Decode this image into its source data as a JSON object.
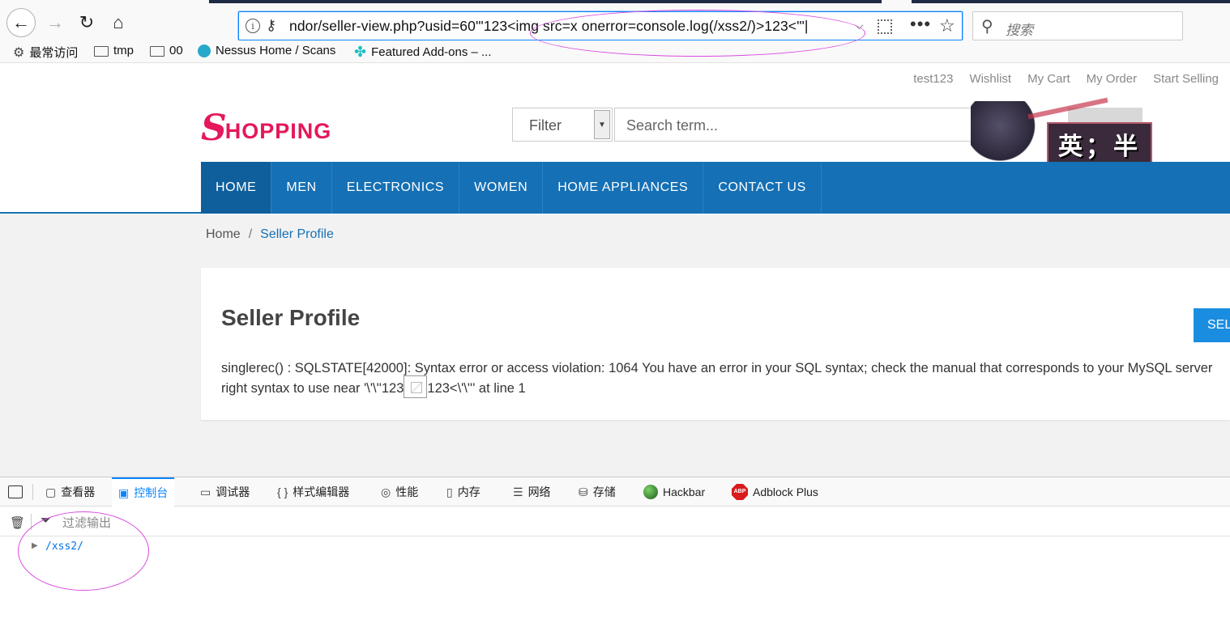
{
  "browser": {
    "nav": {
      "back_icon": "←",
      "forward_icon": "→",
      "reload_icon": "↻",
      "home_icon": "⌂"
    },
    "url": "ndor/seller-view.php?usid=60'\"123<img src=x onerror=console.log(/xss2/)>123<'\"|",
    "url_more_icon": "•••",
    "url_star_icon": "☆",
    "search_placeholder": "搜索",
    "bookmarks": [
      {
        "label": "最常访问"
      },
      {
        "label": "tmp"
      },
      {
        "label": "00"
      },
      {
        "label": "Nessus Home / Scans"
      },
      {
        "label": "Featured Add-ons – ..."
      }
    ]
  },
  "site": {
    "top_links": [
      "test123",
      "Wishlist",
      "My Cart",
      "My Order",
      "Start Selling"
    ],
    "logo_first": "S",
    "logo_rest": "HOPPING",
    "filter_label": "Filter",
    "search_placeholder": "Search term...",
    "sticker_text": "英；半",
    "menu": [
      "HOME",
      "MEN",
      "ELECTRONICS",
      "WOMEN",
      "HOME APPLIANCES",
      "CONTACT US"
    ],
    "breadcrumb": {
      "home": "Home",
      "sep": "/",
      "current": "Seller Profile"
    },
    "card": {
      "title": "Seller Profile",
      "button": "SEL",
      "error_line1": "singlerec() : SQLSTATE[42000]: Syntax error or access violation: 1064 You have an error in your SQL syntax; check the manual that corresponds to your MySQL server",
      "error_line2_pre": "right syntax to use near '\\'\\''123",
      "error_line2_post": "123<\\'\\''' at line 1"
    }
  },
  "devtools": {
    "tabs": [
      {
        "icon": "▢",
        "label": "查看器"
      },
      {
        "icon": "▣",
        "label": "控制台"
      },
      {
        "icon": "▭",
        "label": "调试器"
      },
      {
        "icon": "{ }",
        "label": "样式编辑器"
      },
      {
        "icon": "◎",
        "label": "性能"
      },
      {
        "icon": "▯",
        "label": "内存"
      },
      {
        "icon": "☰",
        "label": "网络"
      },
      {
        "icon": "⛁",
        "label": "存储"
      },
      {
        "icon": "",
        "label": "Hackbar"
      },
      {
        "icon": "ABP",
        "label": "Adblock Plus"
      }
    ],
    "filter_placeholder": "过滤输出",
    "log_message": "/xss2/"
  }
}
